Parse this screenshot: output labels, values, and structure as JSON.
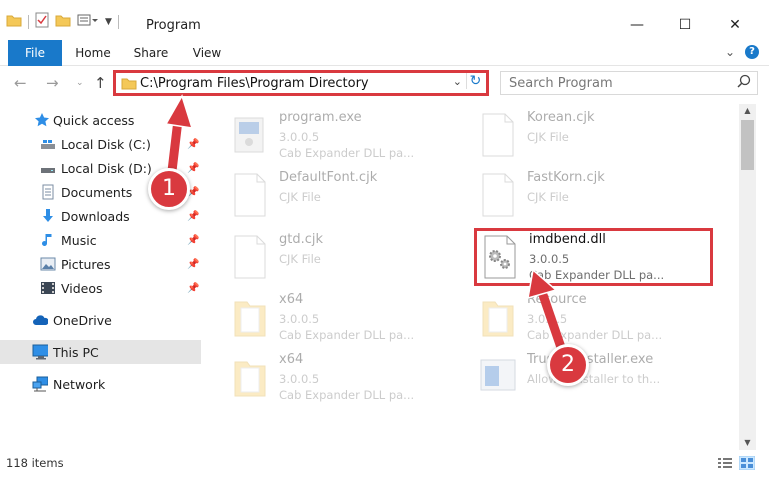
{
  "window": {
    "title": "Program",
    "minimize": "—",
    "maximize": "☐",
    "close": "✕"
  },
  "ribbon": {
    "tabs": [
      "File",
      "Home",
      "Share",
      "View"
    ],
    "expand": "⌄",
    "help": "?"
  },
  "address": {
    "path": "C:\\Program Files\\Program Directory",
    "dropdown": "⌄",
    "refresh": "↻"
  },
  "search": {
    "placeholder": "Search Program"
  },
  "sidebar": {
    "items": [
      {
        "label": "Quick access",
        "icon": "star-icon"
      },
      {
        "label": "Local Disk (C:)",
        "icon": "drive-icon"
      },
      {
        "label": "Local Disk (D:)",
        "icon": "drive-icon"
      },
      {
        "label": "Documents",
        "icon": "documents-icon"
      },
      {
        "label": "Downloads",
        "icon": "download-icon"
      },
      {
        "label": "Music",
        "icon": "music-icon"
      },
      {
        "label": "Pictures",
        "icon": "pictures-icon"
      },
      {
        "label": "Videos",
        "icon": "videos-icon"
      },
      {
        "label": "OneDrive",
        "icon": "cloud-icon"
      },
      {
        "label": "This PC",
        "icon": "computer-icon"
      },
      {
        "label": "Network",
        "icon": "network-icon"
      }
    ]
  },
  "files": [
    {
      "name": "program.exe",
      "line1": "3.0.0.5",
      "line2": "Cab Expander DLL pa..."
    },
    {
      "name": "Korean.cjk",
      "line1": "CJK File",
      "line2": ""
    },
    {
      "name": "DefaultFont.cjk",
      "line1": "CJK File",
      "line2": ""
    },
    {
      "name": "FastKorn.cjk",
      "line1": "CJK File",
      "line2": ""
    },
    {
      "name": "gtd.cjk",
      "line1": "CJK File",
      "line2": ""
    },
    {
      "name": "imdbend.dll",
      "line1": "3.0.0.5",
      "line2": "Cab Expander DLL pa..."
    },
    {
      "name": "x64",
      "line1": "3.0.0.5",
      "line2": "Cab Expander DLL pa..."
    },
    {
      "name": "Resource",
      "line1": "3.0.0.5",
      "line2": "Cab Expander DLL pa..."
    },
    {
      "name": "x64",
      "line1": "3.0.0.5",
      "line2": "Cab Expander DLL pa..."
    },
    {
      "name": "TrustedInstaller.exe",
      "line1": "AllowedInstaller to th...",
      "line2": ""
    }
  ],
  "status": {
    "count": "118 items"
  },
  "annotations": {
    "step1": "1",
    "step2": "2",
    "color": "#d9393f"
  }
}
